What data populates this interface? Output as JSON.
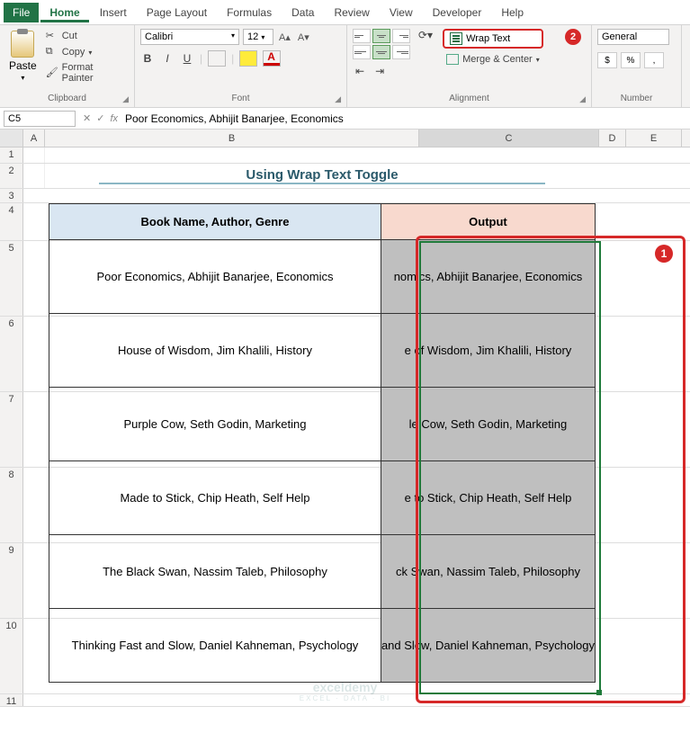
{
  "tabs": {
    "file": "File",
    "home": "Home",
    "insert": "Insert",
    "page_layout": "Page Layout",
    "formulas": "Formulas",
    "data": "Data",
    "review": "Review",
    "view": "View",
    "developer": "Developer",
    "help": "Help"
  },
  "clipboard": {
    "paste": "Paste",
    "cut": "Cut",
    "copy": "Copy",
    "format_painter": "Format Painter",
    "group": "Clipboard"
  },
  "font": {
    "name": "Calibri",
    "size": "12",
    "group": "Font"
  },
  "alignment": {
    "wrap_text": "Wrap Text",
    "merge": "Merge & Center",
    "group": "Alignment"
  },
  "number": {
    "format": "General",
    "group": "Number"
  },
  "name_box": "C5",
  "formula_bar": "Poor Economics, Abhijit Banarjee, Economics",
  "columns": {
    "A": "A",
    "B": "B",
    "C": "C",
    "D": "D",
    "E": "E"
  },
  "rows": [
    "1",
    "2",
    "3",
    "4",
    "5",
    "6",
    "7",
    "8",
    "9",
    "10",
    "11"
  ],
  "title": "Using Wrap Text Toggle",
  "headers": {
    "col_b": "Book Name, Author, Genre",
    "col_c": "Output"
  },
  "data_rows": [
    {
      "b": "Poor Economics, Abhijit Banarjee, Economics",
      "c_display": "nomics, Abhijit Banarjee, Economics"
    },
    {
      "b": "House of Wisdom, Jim Khalili, History",
      "c_display": "e of Wisdom, Jim Khalili, History"
    },
    {
      "b": "Purple Cow, Seth Godin, Marketing",
      "c_display": "le Cow, Seth Godin, Marketing"
    },
    {
      "b": "Made to Stick, Chip Heath, Self Help",
      "c_display": "e to Stick, Chip Heath, Self Help"
    },
    {
      "b": "The Black Swan, Nassim Taleb, Philosophy",
      "c_display": "ck Swan, Nassim Taleb, Philosophy"
    },
    {
      "b": "Thinking Fast and Slow, Daniel Kahneman, Psychology",
      "c_display": "and Slow, Daniel Kahneman, Psychology"
    }
  ],
  "callouts": {
    "one": "1",
    "two": "2"
  },
  "watermark": {
    "main": "exceldemy",
    "sub": "EXCEL · DATA · BI"
  }
}
